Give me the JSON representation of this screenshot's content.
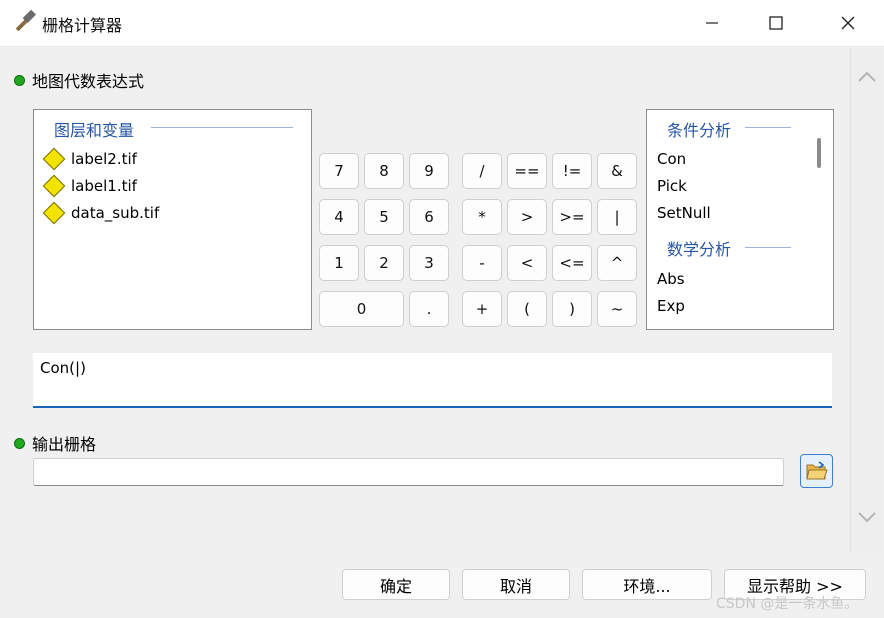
{
  "window": {
    "title": "栅格计算器",
    "app_icon": "hammer-icon",
    "controls": {
      "minimize": "—",
      "maximize": "☐",
      "close": "✕"
    }
  },
  "map_algebra": {
    "label": "地图代数表达式",
    "layers": {
      "header": "图层和变量",
      "items": [
        {
          "name": "label2.tif",
          "icon": "raster-diamond-icon"
        },
        {
          "name": "label1.tif",
          "icon": "raster-diamond-icon"
        },
        {
          "name": "data_sub.tif",
          "icon": "raster-diamond-icon"
        }
      ]
    },
    "keypad": {
      "numbers": [
        "7",
        "8",
        "9",
        "4",
        "5",
        "6",
        "1",
        "2",
        "3",
        "0",
        "."
      ],
      "operators": [
        "/",
        "==",
        "!=",
        "&",
        "*",
        ">",
        ">=",
        "|",
        "-",
        "<",
        "<=",
        "^",
        "+",
        "(",
        ")",
        "~"
      ]
    },
    "functions": {
      "conditional_header": "条件分析",
      "conditional": [
        "Con",
        "Pick",
        "SetNull"
      ],
      "math_header": "数学分析",
      "math": [
        "Abs",
        "Exp"
      ]
    },
    "expression": "Con(|)"
  },
  "output": {
    "label": "输出栅格",
    "value": "",
    "browse_icon": "open-folder-icon"
  },
  "buttons": {
    "ok": "确定",
    "cancel": "取消",
    "environments": "环境...",
    "help": "显示帮助 >>"
  },
  "watermark": "CSDN @是一条水鱼。",
  "colors": {
    "accent": "#1464b8",
    "group_header": "#2756a6",
    "required_dot": "#1fa81f",
    "raster_diamond": "#f2e300"
  }
}
